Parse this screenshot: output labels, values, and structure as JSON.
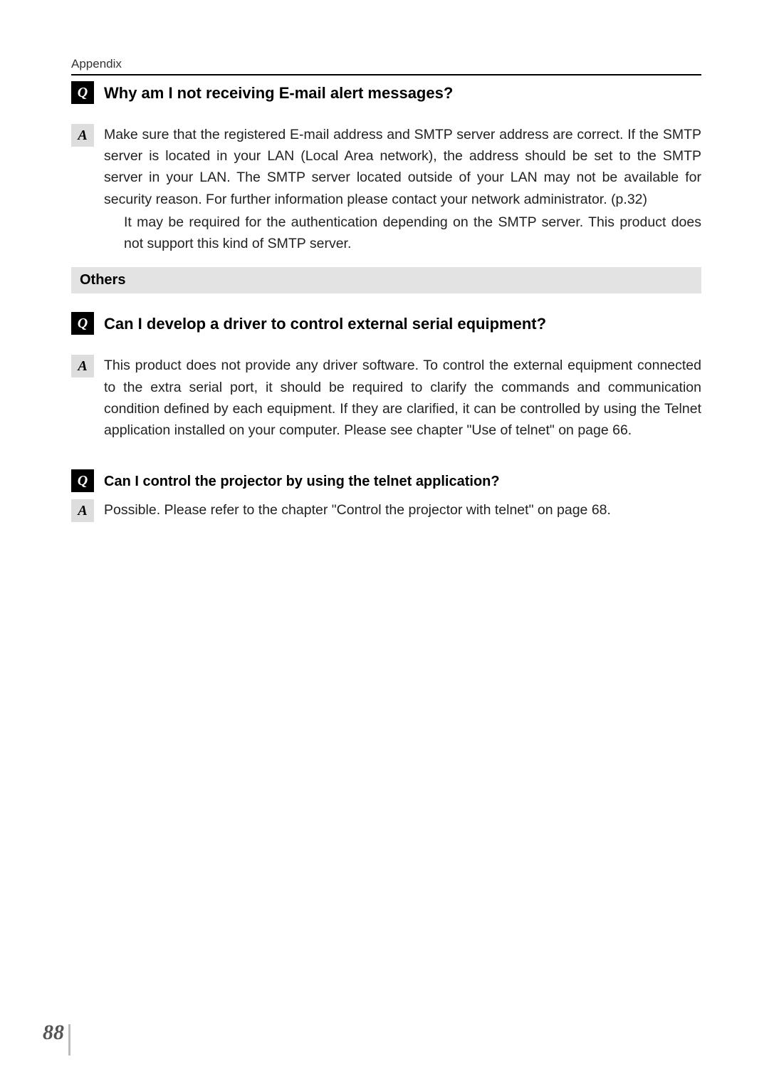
{
  "header": {
    "section": "Appendix"
  },
  "qa1": {
    "q_label": "Q",
    "question": "Why am I not receiving E-mail alert messages?",
    "a_label": "A",
    "answer_main": "Make sure that the registered E-mail address and SMTP server address are correct. If the SMTP server is located in your LAN (Local Area network), the address should be set to the SMTP server in your LAN. The SMTP server located outside of your LAN may not be available for security reason. For further information please contact your network administrator. (p.32)",
    "answer_sub": "It may be required for the authentication depending on the SMTP server. This product does not support this kind of SMTP server."
  },
  "section2": {
    "title": "Others"
  },
  "qa2": {
    "q_label": "Q",
    "question": "Can I develop a driver to control external serial equipment?",
    "a_label": "A",
    "answer": "This product does not provide any driver software. To control the external equipment connected to the extra serial port, it should be required to clarify the commands and communication condition defined by each equipment. If they are clarified, it can be controlled by using the Telnet application installed on your computer. Please see chapter \"Use of telnet\" on page 66."
  },
  "qa3": {
    "q_label": "Q",
    "question": "Can I control the projector by using the telnet application?",
    "a_label": "A",
    "answer": "Possible. Please refer to the chapter \"Control the projector with telnet\" on page 68."
  },
  "footer": {
    "page_number": "88"
  }
}
